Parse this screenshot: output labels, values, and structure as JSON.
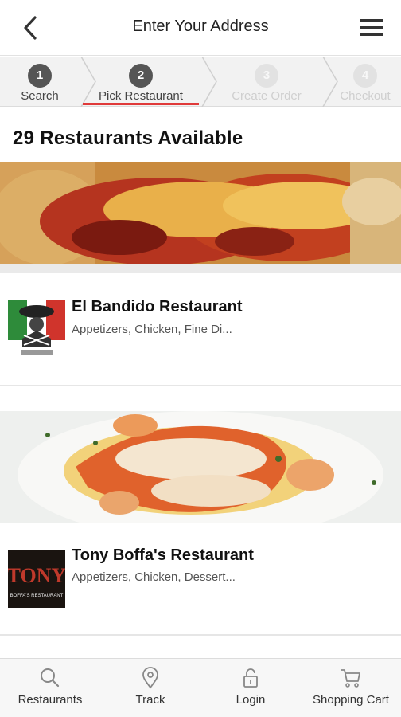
{
  "header": {
    "title": "Enter Your Address"
  },
  "steps": [
    {
      "number": "1",
      "label": "Search",
      "state": "done"
    },
    {
      "number": "2",
      "label": "Pick Restaurant",
      "state": "active"
    },
    {
      "number": "3",
      "label": "Create Order",
      "state": "pending"
    },
    {
      "number": "4",
      "label": "Checkout",
      "state": "pending"
    }
  ],
  "restaurants_heading": "29 Restaurants Available",
  "restaurants": [
    {
      "name": "El Bandido Restaurant",
      "tags": "Appetizers, Chicken, Fine Di...",
      "logo_text": "EL BANDIDO"
    },
    {
      "name": "Tony Boffa's Restaurant",
      "tags": "Appetizers, Chicken, Dessert...",
      "logo_text": "TONY",
      "logo_subtext": "BOFFA'S RESTAURANT"
    }
  ],
  "tabbar": {
    "restaurants": "Restaurants",
    "track": "Track",
    "login": "Login",
    "cart": "Shopping Cart"
  },
  "colors": {
    "accent_underline": "#e03a3a",
    "step_active": "#555555",
    "step_pending": "#e2e2e2"
  },
  "icons": [
    "back-arrow-icon",
    "hamburger-menu-icon",
    "search-icon",
    "location-pin-icon",
    "lock-icon",
    "cart-icon"
  ]
}
